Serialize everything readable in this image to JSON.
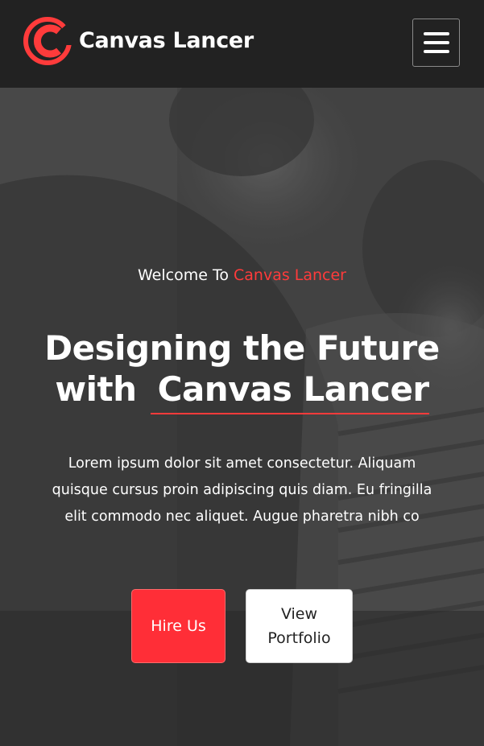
{
  "navbar": {
    "brand_name": "Canvas Lancer",
    "logo_icon": "canvas-lancer-logo",
    "menu_icon": "hamburger-menu-icon"
  },
  "hero": {
    "welcome_prefix": "Welcome To",
    "welcome_accent": "Canvas Lancer",
    "headline_line1": "Designing the Future",
    "headline_line2_prefix": "with",
    "headline_line2_brand": "Canvas Lancer",
    "lead_lines": [
      "Lorem ipsum dolor sit amet consectetur. Aliquam",
      "quisque cursus proin adipiscing quis diam. Eu fringilla",
      "elit commodo nec aliquet. Augue pharetra nibh co"
    ],
    "hire_button": "Hire Us",
    "portfolio_button": "View Portfolio"
  },
  "colors": {
    "accent": "#ff2e37",
    "navbar_bg": "#222222",
    "text": "#ffffff"
  }
}
